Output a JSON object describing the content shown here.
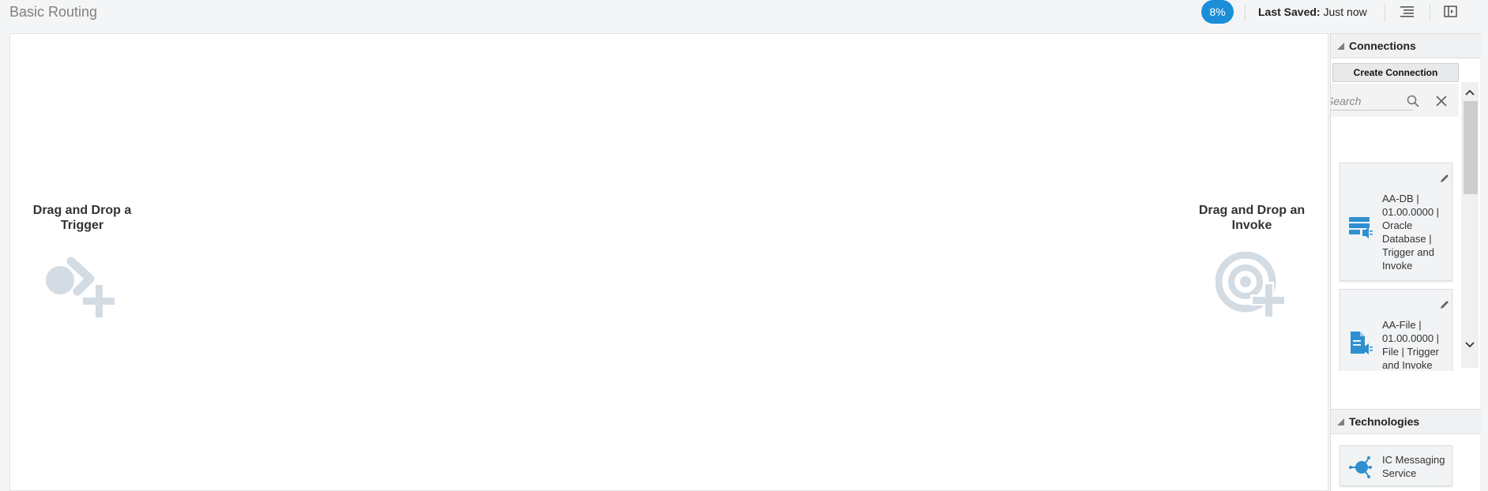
{
  "header": {
    "title": "Basic Routing",
    "progress": "8%",
    "last_saved_label": "Last Saved:",
    "last_saved_value": "Just now"
  },
  "canvas": {
    "trigger_label": "Drag and Drop a Trigger",
    "invoke_label": "Drag and Drop an Invoke"
  },
  "panel": {
    "connections": {
      "title": "Connections",
      "create_label": "Create Connection",
      "search_placeholder": "Search",
      "items": [
        {
          "label": "AA-DB | 01.00.0000 | Oracle Database | Trigger and Invoke",
          "icon": "database-adapter-icon"
        },
        {
          "label": "AA-File | 01.00.0000 | File | Trigger and Invoke",
          "icon": "file-adapter-icon"
        }
      ]
    },
    "technologies": {
      "title": "Technologies",
      "items": [
        {
          "label": "IC Messaging Service",
          "icon": "messaging-service-icon"
        }
      ]
    }
  },
  "colors": {
    "accent": "#1a8fd8",
    "icon_blue": "#2f8fd0",
    "placeholder_gray": "#d3dbe3"
  }
}
